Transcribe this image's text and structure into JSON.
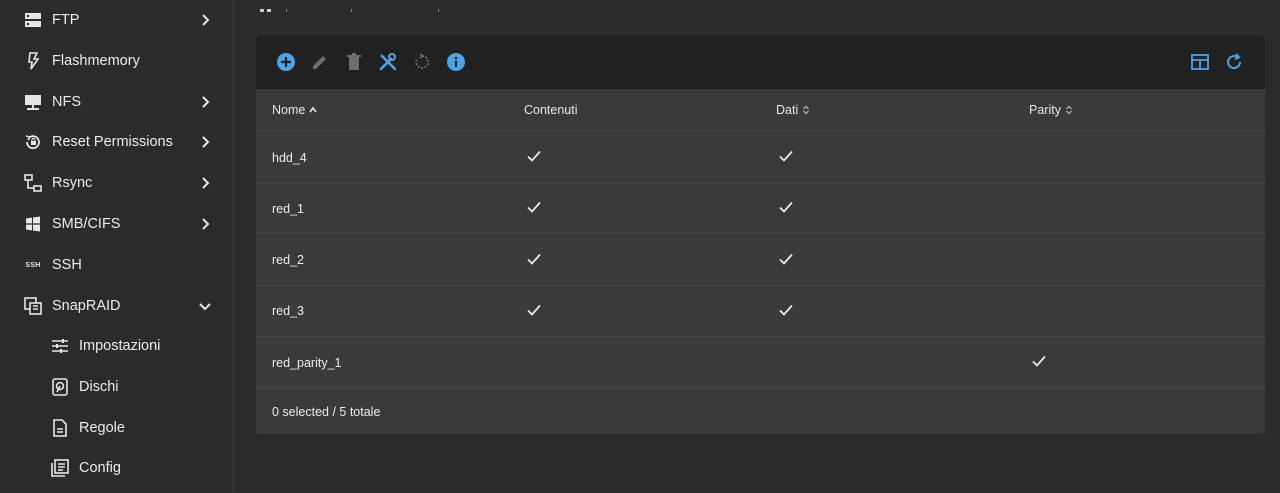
{
  "sidebar": {
    "items": [
      {
        "label": "FTP",
        "icon": "server-icon",
        "has_chevron": true
      },
      {
        "label": "Flashmemory",
        "icon": "flash-icon",
        "has_chevron": false
      },
      {
        "label": "NFS",
        "icon": "monitor-network-icon",
        "has_chevron": true
      },
      {
        "label": "Reset Permissions",
        "icon": "reset-lock-icon",
        "has_chevron": true
      },
      {
        "label": "Rsync",
        "icon": "rsync-icon",
        "has_chevron": true
      },
      {
        "label": "SMB/CIFS",
        "icon": "windows-icon",
        "has_chevron": true
      },
      {
        "label": "SSH",
        "icon": "ssh-icon",
        "has_chevron": false
      },
      {
        "label": "SnapRAID",
        "icon": "snapraid-icon",
        "has_chevron": true,
        "expanded": true
      }
    ],
    "subitems": [
      {
        "label": "Impostazioni",
        "icon": "sliders-icon"
      },
      {
        "label": "Dischi",
        "icon": "disk-icon"
      },
      {
        "label": "Regole",
        "icon": "file-document-icon"
      },
      {
        "label": "Config",
        "icon": "config-list-icon"
      }
    ],
    "ssh_icon_text": "SSH"
  },
  "toolbar": {
    "buttons": [
      "add-circle-icon",
      "pencil-icon",
      "trash-icon",
      "tools-icon",
      "restore-icon",
      "info-icon"
    ],
    "right_buttons": [
      "table-columns-icon",
      "refresh-icon"
    ],
    "accent": "#4ea1e4"
  },
  "table": {
    "columns": [
      "Nome",
      "Contenuti",
      "Dati",
      "Parity"
    ],
    "rows": [
      {
        "name": "hdd_4",
        "content": true,
        "data": true,
        "parity": false
      },
      {
        "name": "red_1",
        "content": true,
        "data": true,
        "parity": false
      },
      {
        "name": "red_2",
        "content": true,
        "data": true,
        "parity": false
      },
      {
        "name": "red_3",
        "content": true,
        "data": true,
        "parity": false
      },
      {
        "name": "red_parity_1",
        "content": false,
        "data": false,
        "parity": true
      }
    ],
    "footer": "0 selected / 5 totale"
  }
}
